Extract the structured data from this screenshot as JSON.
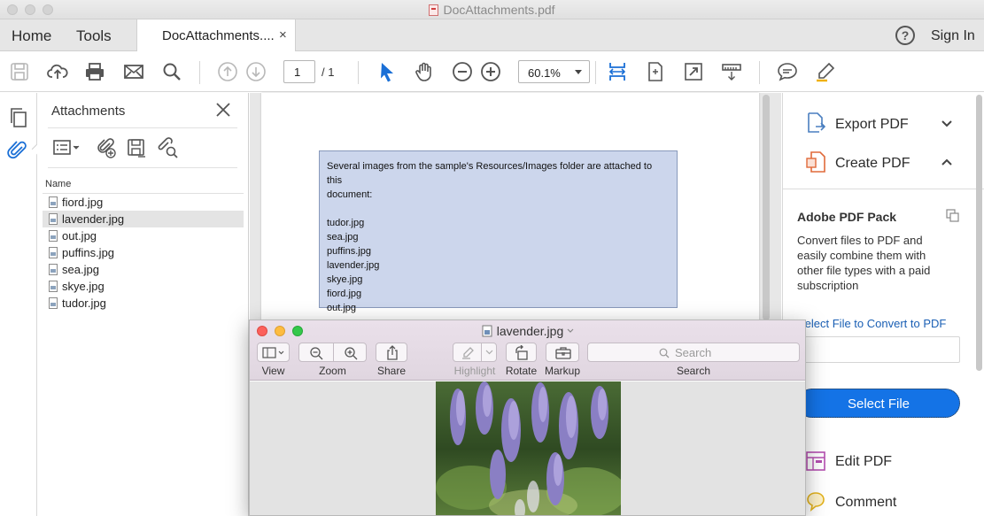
{
  "window": {
    "title": "DocAttachments.pdf"
  },
  "tabs": {
    "home": "Home",
    "tools": "Tools",
    "document": "DocAttachments....",
    "close": "×"
  },
  "header": {
    "help": "?",
    "sign_in": "Sign In"
  },
  "toolbar": {
    "page_current": "1",
    "page_total": "/ 1",
    "zoom": "60.1%"
  },
  "attachments": {
    "title": "Attachments",
    "column_name": "Name",
    "files": [
      {
        "name": "fiord.jpg",
        "selected": false
      },
      {
        "name": "lavender.jpg",
        "selected": true
      },
      {
        "name": "out.jpg",
        "selected": false
      },
      {
        "name": "puffins.jpg",
        "selected": false
      },
      {
        "name": "sea.jpg",
        "selected": false
      },
      {
        "name": "skye.jpg",
        "selected": false
      },
      {
        "name": "tudor.jpg",
        "selected": false
      }
    ]
  },
  "document": {
    "note_lines": [
      "Several images from the sample's Resources/Images folder are attached to this",
      "document:",
      "",
      "tudor.jpg",
      "sea.jpg",
      "puffins.jpg",
      "lavender.jpg",
      "skye.jpg",
      "fiord.jpg",
      "out.jpg"
    ]
  },
  "right_panel": {
    "export_pdf": "Export PDF",
    "create_pdf": "Create PDF",
    "pack_title": "Adobe PDF Pack",
    "pack_desc": "Convert files to PDF and easily combine them with other file types with a paid subscription",
    "select_link": "Select File to Convert to PDF",
    "select_button": "Select File",
    "edit_pdf": "Edit PDF",
    "comment": "Comment"
  },
  "preview": {
    "title": "lavender.jpg",
    "labels": {
      "view": "View",
      "zoom": "Zoom",
      "share": "Share",
      "highlight": "Highlight",
      "rotate": "Rotate",
      "markup": "Markup",
      "search": "Search"
    },
    "search_placeholder": "Search"
  },
  "colors": {
    "accent": "#1473e6",
    "note_bg": "#ccd6ec",
    "selected_row": "#e4e4e4",
    "pointer_tool": "#1a6fd6"
  },
  "icons": [
    "save-icon",
    "upload-icon",
    "print-icon",
    "email-icon",
    "search-icon",
    "prev-page-icon",
    "next-page-icon",
    "select-tool-icon",
    "hand-tool-icon",
    "zoom-out-icon",
    "zoom-in-icon",
    "fit-width-icon",
    "rotate-page-icon",
    "fullscreen-icon",
    "read-mode-icon",
    "comment-icon",
    "highlight-pen-icon"
  ]
}
